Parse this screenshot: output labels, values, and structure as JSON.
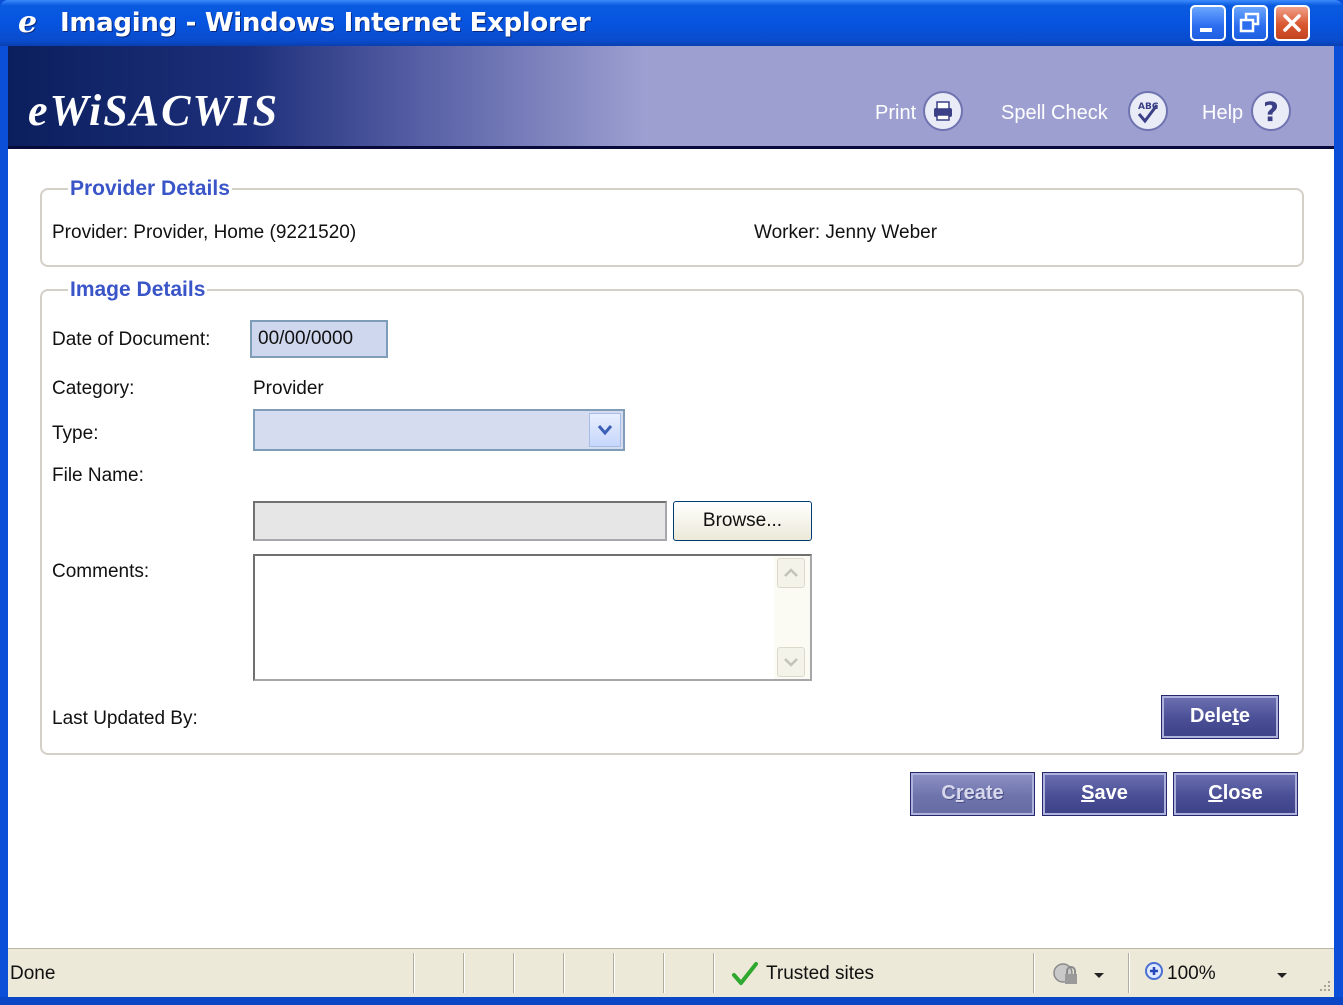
{
  "window": {
    "title": "Imaging - Windows Internet Explorer"
  },
  "banner": {
    "logo": "eWiSACWIS",
    "print_label": "Print",
    "spell_check_label": "Spell Check",
    "help_label": "Help"
  },
  "provider_details": {
    "legend": "Provider Details",
    "provider_text": "Provider: Provider, Home (9221520)",
    "worker_text": "Worker: Jenny Weber"
  },
  "image_details": {
    "legend": "Image Details",
    "date_label": "Date of Document:",
    "date_value": "00/00/0000",
    "category_label": "Category:",
    "category_value": "Provider",
    "type_label": "Type:",
    "type_value": "",
    "file_name_label": "File Name:",
    "file_name_value": "",
    "browse_label": "Browse...",
    "comments_label": "Comments:",
    "comments_value": "",
    "last_updated_label": "Last Updated By:",
    "delete_label_pre": "Dele",
    "delete_label_u": "t",
    "delete_label_post": "e"
  },
  "actions": {
    "create_pre": "C",
    "create_u": "r",
    "create_post": "eate",
    "save_u": "S",
    "save_post": "ave",
    "close_u": "C",
    "close_post": "lose"
  },
  "status": {
    "text": "Done",
    "zone": "Trusted sites",
    "zoom": "100%"
  }
}
